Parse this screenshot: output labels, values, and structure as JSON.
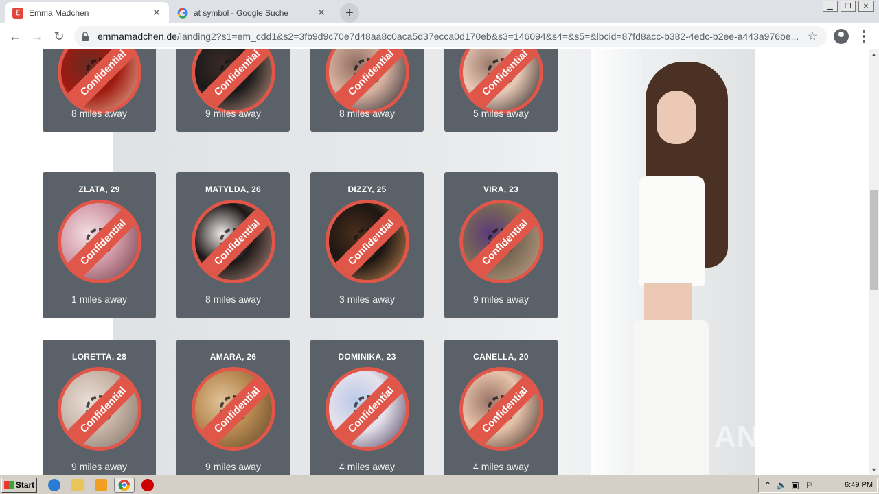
{
  "browser": {
    "tabs": [
      {
        "title": "Emma Madchen",
        "favicon": "emma-favicon",
        "active": true
      },
      {
        "title": "at symbol - Google Suche",
        "favicon": "google-favicon",
        "active": false
      }
    ],
    "address": {
      "host": "emmamadchen.de",
      "path": "/landing2?s1=em_cdd1&s2=3fb9d9c70e7d48aa8c0aca5d37ecca0d170eb&s3=146094&s4=&s5=&lbcid=87fd8acc-b382-4edc-b2ee-a443a976be..."
    }
  },
  "profiles": [
    {
      "name": "",
      "distance": "8 miles away",
      "colors": [
        "#a01a10",
        "#e7b9a0",
        "#6b2a22"
      ]
    },
    {
      "name": "",
      "distance": "9 miles away",
      "colors": [
        "#1a1a1a",
        "#c89b86",
        "#3a2a25"
      ]
    },
    {
      "name": "",
      "distance": "8 miles away",
      "colors": [
        "#d9b2a0",
        "#1c1f2c",
        "#8f6f62"
      ]
    },
    {
      "name": "",
      "distance": "5 miles away",
      "colors": [
        "#e9c9b7",
        "#181818",
        "#9c7b6c"
      ]
    },
    {
      "name": "ZLATA, 29",
      "distance": "1 miles away",
      "colors": [
        "#d29aa8",
        "#6a3a44",
        "#f2dfe3"
      ]
    },
    {
      "name": "MATYLDA, 26",
      "distance": "8 miles away",
      "colors": [
        "#1c1716",
        "#b99084",
        "#f1ebe8"
      ]
    },
    {
      "name": "DIZZY, 25",
      "distance": "3 miles away",
      "colors": [
        "#1d1612",
        "#c88c55",
        "#4a2e1c"
      ]
    },
    {
      "name": "VIRA, 23",
      "distance": "9 miles away",
      "colors": [
        "#7b6a55",
        "#c2a48c",
        "#5b3a7a"
      ]
    },
    {
      "name": "LORETTA, 28",
      "distance": "9 miles away",
      "colors": [
        "#c8b5a8",
        "#7e6f66",
        "#e9ded6"
      ]
    },
    {
      "name": "AMARA, 26",
      "distance": "9 miles away",
      "colors": [
        "#b88a52",
        "#5e4426",
        "#e0c39a"
      ]
    },
    {
      "name": "DOMINIKA, 23",
      "distance": "4 miles away",
      "colors": [
        "#e6e2ec",
        "#4a3b5a",
        "#b9c9e9"
      ]
    },
    {
      "name": "CANELLA, 20",
      "distance": "4 miles away",
      "colors": [
        "#e7c3ab",
        "#3c2a22",
        "#9a7466"
      ]
    }
  ],
  "badge_label": "Confidential",
  "watermark": "ANY RUN",
  "taskbar": {
    "start_label": "Start",
    "clock": "6:49 PM"
  }
}
